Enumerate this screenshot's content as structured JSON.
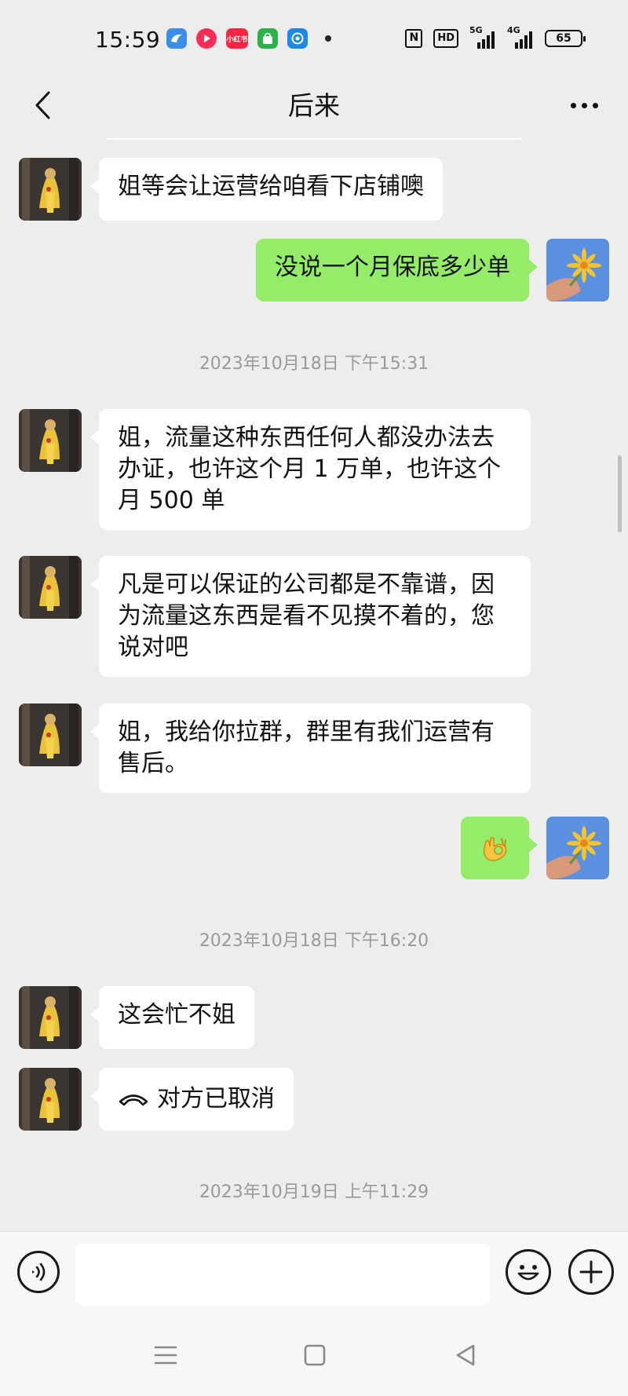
{
  "status_bar": {
    "time": "15:59",
    "apps": [
      {
        "icon": "bird-app-icon",
        "color": "#3a8ee6",
        "label": ""
      },
      {
        "icon": "video-app-icon",
        "color": "#ff2d55",
        "label": ""
      },
      {
        "icon": "xiaohongshu-app-icon",
        "color": "#ff2442",
        "label": "小红书"
      },
      {
        "icon": "shopping-bag-app-icon",
        "color": "#2bb34a",
        "label": ""
      },
      {
        "icon": "browser-app-icon",
        "color": "#1e88e5",
        "label": ""
      }
    ],
    "nfc_label": "N",
    "hd_label": "HD",
    "signal_1_label": "5G",
    "signal_2_label": "4G",
    "battery": "65"
  },
  "header": {
    "title": "后来"
  },
  "messages": [
    {
      "side": "in",
      "text": "姐等会让运营给咱看下店铺噢"
    },
    {
      "side": "out",
      "text": "没说一个月保底多少单"
    },
    {
      "type": "time",
      "text": "2023年10月18日 下午15:31"
    },
    {
      "side": "in",
      "text": "姐，流量这种东西任何人都没办法去办证，也许这个月 1 万单，也许这个月 500 单"
    },
    {
      "side": "in",
      "text": "凡是可以保证的公司都是不靠谱，因为流量这东西是看不见摸不着的，您说对吧"
    },
    {
      "side": "in",
      "text": "姐，我给你拉群，群里有我们运营有售后。"
    },
    {
      "side": "out",
      "type": "emoji",
      "icon": "ok-hand-emoji"
    },
    {
      "type": "time",
      "text": "2023年10月18日 下午16:20"
    },
    {
      "side": "in",
      "text": "这会忙不姐"
    },
    {
      "side": "in",
      "type": "call",
      "icon": "phone-hangup-icon",
      "text": "对方已取消"
    },
    {
      "type": "time",
      "text": "2023年10月19日 上午11:29"
    }
  ],
  "input_bar": {
    "value": "",
    "voice_icon": "voice-icon",
    "emoji_icon": "emoji-icon",
    "plus_icon": "plus-icon"
  },
  "colors": {
    "background": "#ededed",
    "outgoing_bubble": "#95ec69",
    "incoming_bubble": "#ffffff",
    "timestamp_text": "#9a9a9a"
  }
}
